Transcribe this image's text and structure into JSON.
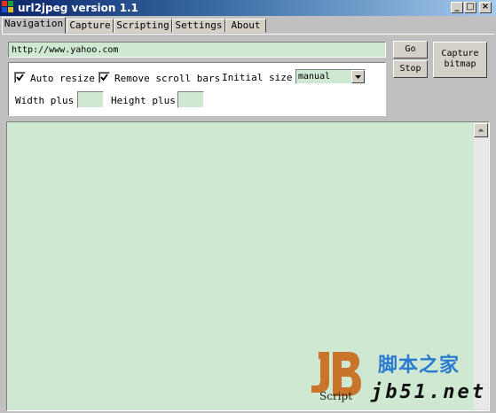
{
  "window": {
    "title": "url2jpeg version 1.1",
    "controls": {
      "minimize": "_",
      "maximize": "□",
      "close": "×"
    }
  },
  "tabs": [
    {
      "label": "Navigation",
      "active": true
    },
    {
      "label": "Capture",
      "active": false
    },
    {
      "label": "Scripting",
      "active": false
    },
    {
      "label": "Settings",
      "active": false
    },
    {
      "label": "About",
      "active": false
    }
  ],
  "navigation": {
    "url_value": "http://www.yahoo.com",
    "go_label": "Go",
    "stop_label": "Stop",
    "capture_label_line1": "Capture",
    "capture_label_line2": "bitmap",
    "auto_resize": {
      "label": "Auto resize",
      "checked": true
    },
    "remove_scroll_bars": {
      "label": "Remove scroll bars",
      "checked": true
    },
    "initial_size": {
      "label": "Initial size",
      "value": "manual"
    },
    "width_plus": {
      "label": "Width plus",
      "value": ""
    },
    "height_plus": {
      "label": "Height plus",
      "value": ""
    }
  },
  "watermark": {
    "script": "Script",
    "chinese": "脚本之家",
    "url": "jb51.net"
  },
  "colors": {
    "field_bg": "#cfe8d2",
    "title_start": "#0a246a",
    "title_end": "#a6caf0",
    "watermark_blue": "#2a7bd0",
    "logo_orange": "#c8742a"
  },
  "icons": {
    "app": "app-icon",
    "check": "checkmark-icon",
    "dropdown": "chevron-down-icon",
    "scroll_up": "arrow-up-icon"
  }
}
